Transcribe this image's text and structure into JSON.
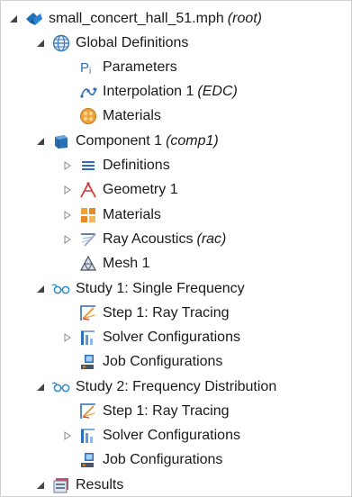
{
  "tree": {
    "root": {
      "label": "small_concert_hall_51.mph",
      "suffix": "(root)",
      "icon": "model-icon"
    },
    "global": {
      "label": "Global Definitions",
      "icon": "globe-icon"
    },
    "parameters": {
      "label": "Parameters",
      "icon": "parameters-icon"
    },
    "interpolation": {
      "label": "Interpolation 1",
      "suffix": "(EDC)",
      "icon": "interpolation-icon"
    },
    "materials_global": {
      "label": "Materials",
      "icon": "materials-icon"
    },
    "component": {
      "label": "Component 1",
      "suffix": "(comp1)",
      "icon": "component-icon"
    },
    "definitions": {
      "label": "Definitions",
      "icon": "definitions-icon"
    },
    "geometry": {
      "label": "Geometry 1",
      "icon": "geometry-icon"
    },
    "materials_comp": {
      "label": "Materials",
      "icon": "materials-grid-icon"
    },
    "ray_acoustics": {
      "label": "Ray Acoustics",
      "suffix": "(rac)",
      "icon": "ray-acoustics-icon"
    },
    "mesh": {
      "label": "Mesh 1",
      "icon": "mesh-icon"
    },
    "study1": {
      "label": "Study 1: Single Frequency",
      "icon": "study-icon"
    },
    "step1a": {
      "label": "Step 1: Ray Tracing",
      "icon": "ray-tracing-step-icon"
    },
    "solver1": {
      "label": "Solver Configurations",
      "icon": "solver-icon"
    },
    "job1": {
      "label": "Job Configurations",
      "icon": "job-icon"
    },
    "study2": {
      "label": "Study 2: Frequency Distribution",
      "icon": "study-icon"
    },
    "step1b": {
      "label": "Step 1: Ray Tracing",
      "icon": "ray-tracing-step-icon"
    },
    "solver2": {
      "label": "Solver Configurations",
      "icon": "solver-icon"
    },
    "job2": {
      "label": "Job Configurations",
      "icon": "job-icon"
    },
    "results": {
      "label": "Results",
      "icon": "results-icon"
    }
  },
  "colors": {
    "accent_blue": "#1f6fb5",
    "orange": "#e8892a",
    "text": "#1a1a1a"
  }
}
